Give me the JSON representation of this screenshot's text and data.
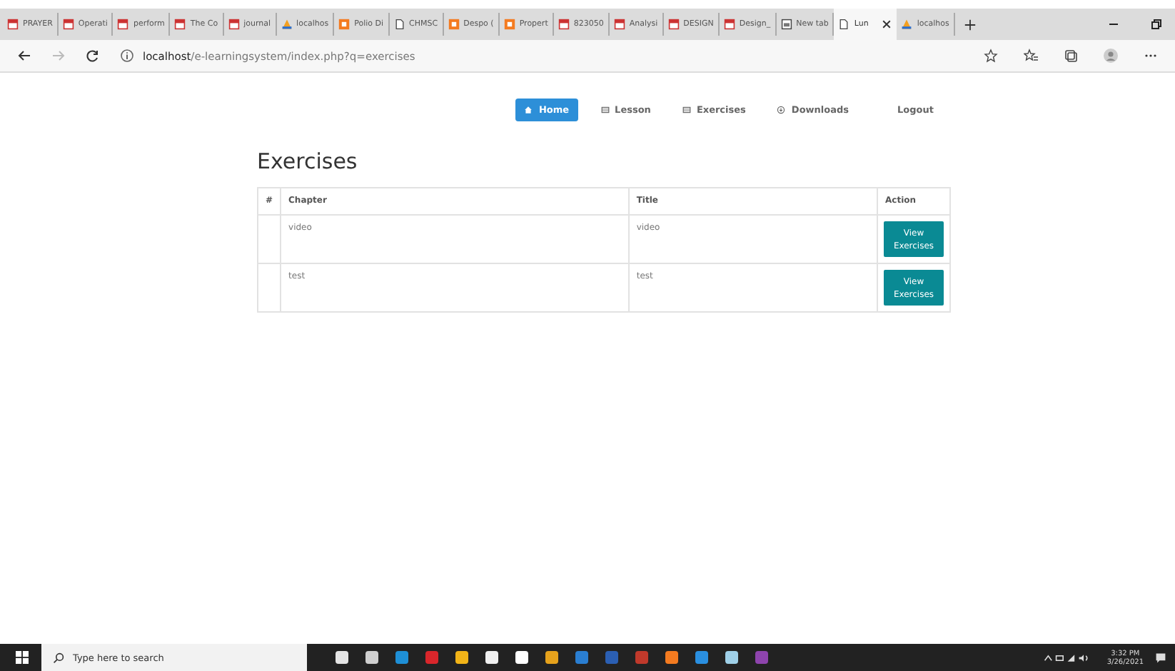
{
  "browser": {
    "tabs": [
      {
        "label": "PRAYER",
        "kind": "pdf",
        "selected": false
      },
      {
        "label": "Operati",
        "kind": "pdf",
        "selected": false
      },
      {
        "label": "perform",
        "kind": "pdf",
        "selected": false
      },
      {
        "label": "The Co",
        "kind": "pdf",
        "selected": false
      },
      {
        "label": "journal",
        "kind": "pdf",
        "selected": false
      },
      {
        "label": "localhos",
        "kind": "xampp",
        "selected": false
      },
      {
        "label": "Polio Di",
        "kind": "app",
        "selected": false
      },
      {
        "label": "CHMSC",
        "kind": "doc",
        "selected": false
      },
      {
        "label": "Despo (",
        "kind": "app",
        "selected": false
      },
      {
        "label": "Propert",
        "kind": "app",
        "selected": false
      },
      {
        "label": "823050",
        "kind": "pdf",
        "selected": false
      },
      {
        "label": "Analysi",
        "kind": "pdf",
        "selected": false
      },
      {
        "label": "DESIGN",
        "kind": "pdf",
        "selected": false
      },
      {
        "label": "Design_",
        "kind": "pdf",
        "selected": false
      },
      {
        "label": "New tab",
        "kind": "newtab",
        "selected": false
      },
      {
        "label": "Lun",
        "kind": "doc",
        "selected": true
      },
      {
        "label": "localhos",
        "kind": "xampp",
        "selected": false
      }
    ],
    "address": {
      "host": "localhost",
      "path": "/e-learningsystem/index.php?q=exercises"
    }
  },
  "nav": [
    {
      "label": "Home",
      "kind": "home",
      "selected": true
    },
    {
      "label": "Lesson",
      "kind": "table",
      "selected": false
    },
    {
      "label": "Exercises",
      "kind": "table",
      "selected": false
    },
    {
      "label": "Downloads",
      "kind": "download",
      "selected": false
    },
    {
      "label": "Logout",
      "kind": "plain",
      "selected": false
    }
  ],
  "heading": "Exercises",
  "table": {
    "columns": [
      "#",
      "Chapter",
      "Title",
      "Action"
    ],
    "rows": [
      {
        "number": "",
        "chapter": "video",
        "title": "video",
        "action": "View Exercises"
      },
      {
        "number": "",
        "chapter": "test",
        "title": "test",
        "action": "View Exercises"
      }
    ]
  },
  "taskbar": {
    "search_placeholder": "Type here to search",
    "apps": [
      {
        "color": "#e5e5e5"
      },
      {
        "color": "#cfcfcf"
      },
      {
        "color": "#1e8fd6"
      },
      {
        "color": "#d9262b"
      },
      {
        "color": "#f2b418"
      },
      {
        "color": "#f0f0f0"
      },
      {
        "color": "#ffffff"
      },
      {
        "color": "#e6a21c"
      },
      {
        "color": "#2a7ed1"
      },
      {
        "color": "#2b5fb3"
      },
      {
        "color": "#c0392b"
      },
      {
        "color": "#f47b20"
      },
      {
        "color": "#2a8fe0"
      },
      {
        "color": "#9fd0e8"
      },
      {
        "color": "#8e44ad"
      }
    ],
    "time": "3:32 PM",
    "date": "3/26/2021"
  }
}
